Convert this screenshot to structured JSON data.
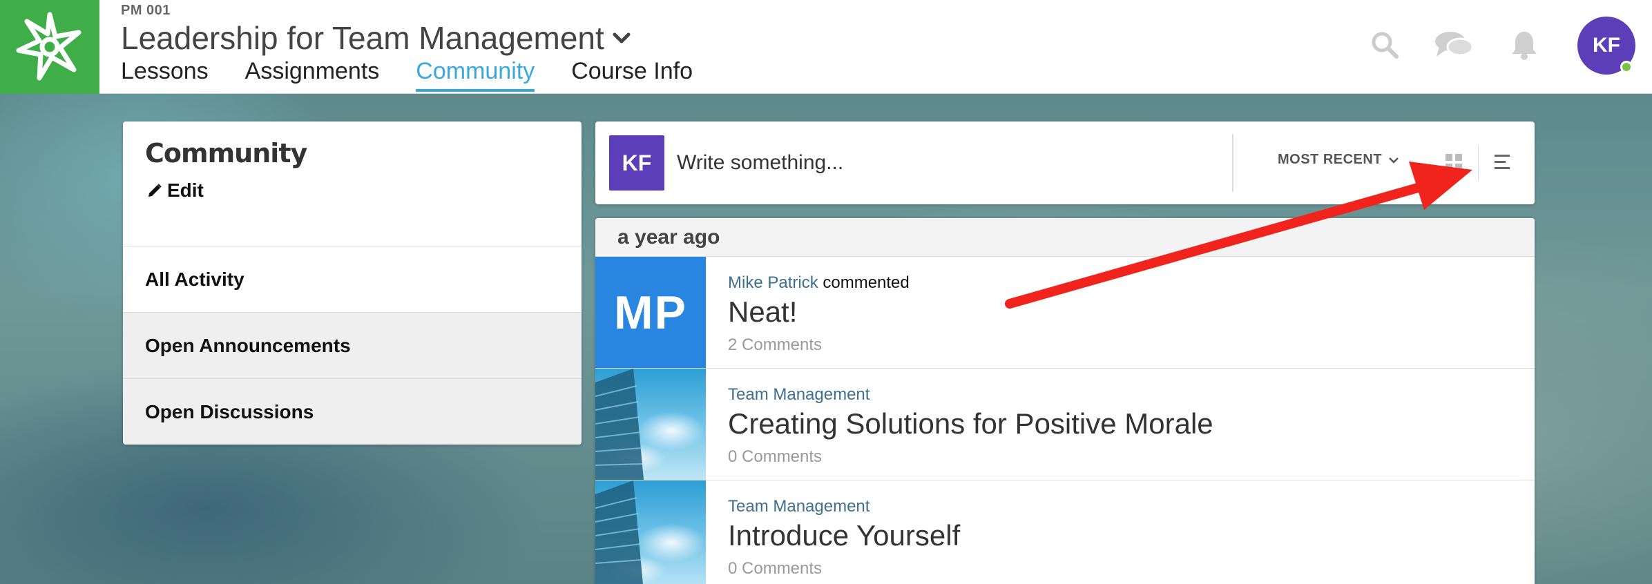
{
  "colors": {
    "brand_green": "#3fae49",
    "accent_blue": "#3aa8dd",
    "avatar_purple": "#5c3fb8",
    "mp_blue": "#2886e0",
    "link_blue": "#3d6f8e",
    "annotation_red": "#f0241c"
  },
  "header": {
    "logo_icon": "asterisk-star-logo",
    "course_code": "PM 001",
    "course_title": "Leadership for Team Management",
    "tabs": [
      {
        "label": "Lessons",
        "active": false
      },
      {
        "label": "Assignments",
        "active": false
      },
      {
        "label": "Community",
        "active": true
      },
      {
        "label": "Course Info",
        "active": false
      }
    ],
    "icons": [
      "search-icon",
      "chat-icon",
      "bell-icon"
    ],
    "avatar_initials": "KF",
    "online": true
  },
  "sidebar": {
    "title": "Community",
    "edit_label": "Edit",
    "items": [
      {
        "label": "All Activity"
      },
      {
        "label": "Open Announcements"
      },
      {
        "label": "Open Discussions"
      }
    ]
  },
  "composer": {
    "avatar_initials": "KF",
    "placeholder": "Write something...",
    "sort_label": "MOST RECENT",
    "view_modes": [
      "grid-view-icon",
      "list-view-icon"
    ]
  },
  "feed": {
    "date_group": "a year ago",
    "posts": [
      {
        "thumb_initials": "MP",
        "author": "Mike Patrick",
        "action": "commented",
        "title": "Neat!",
        "comments": "2 Comments"
      },
      {
        "thumb_initials": "",
        "author": "Team Management",
        "action": "",
        "title": "Creating Solutions for Positive Morale",
        "comments": "0 Comments"
      },
      {
        "thumb_initials": "",
        "author": "Team Management",
        "action": "",
        "title": "Introduce Yourself",
        "comments": "0 Comments"
      }
    ]
  }
}
